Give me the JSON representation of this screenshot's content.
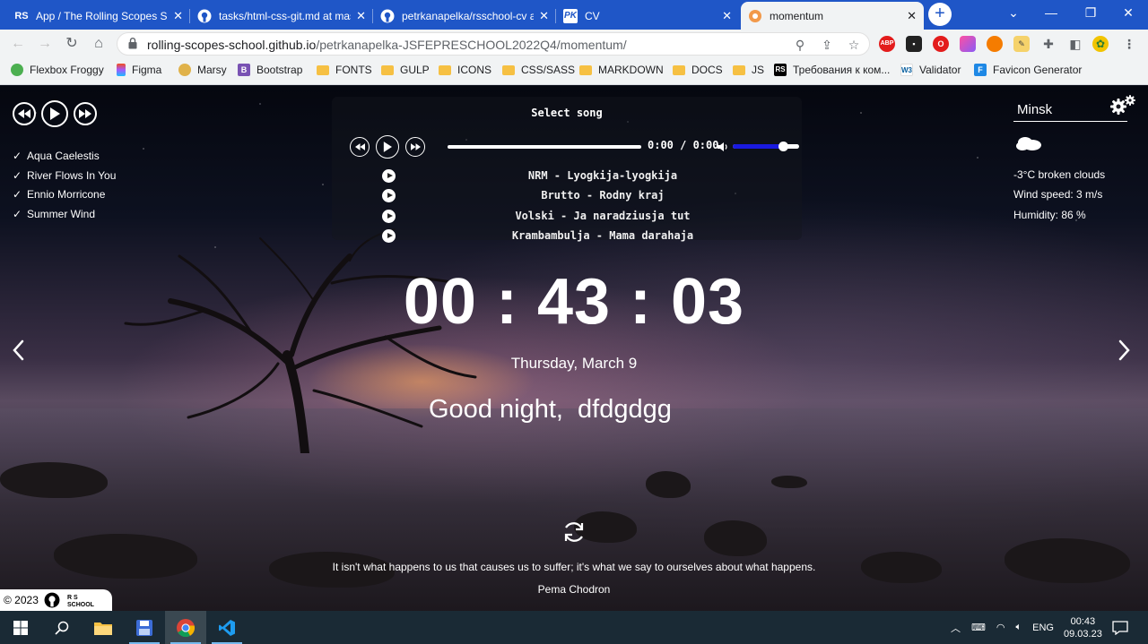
{
  "browser": {
    "tabs": [
      {
        "favicon": "RS",
        "title": "App / The Rolling Scopes Sch",
        "active": false
      },
      {
        "favicon": "github-icon",
        "title": "tasks/html-css-git.md at mas",
        "active": false
      },
      {
        "favicon": "github-icon",
        "title": "petrkanapelka/rsschool-cv at",
        "active": false
      },
      {
        "favicon": "PK",
        "title": "CV",
        "active": false
      },
      {
        "favicon": "momentum-icon",
        "title": "momentum",
        "active": true
      }
    ],
    "url_host": "rolling-scopes-school.github.io",
    "url_path": "/petrkanapelka-JSFEPRESCHOOL2022Q4/momentum/",
    "bookmarks": [
      {
        "icon": "froggy-icon",
        "label": "Flexbox Froggy"
      },
      {
        "icon": "figma-icon",
        "label": "Figma"
      },
      {
        "icon": "marsy-icon",
        "label": "Marsy"
      },
      {
        "icon": "bootstrap-icon",
        "label": "Bootstrap"
      },
      {
        "icon": "folder-icon",
        "label": "FONTS"
      },
      {
        "icon": "folder-icon",
        "label": "GULP"
      },
      {
        "icon": "folder-icon",
        "label": "ICONS"
      },
      {
        "icon": "folder-icon",
        "label": "CSS/SASS"
      },
      {
        "icon": "folder-icon",
        "label": "MARKDOWN"
      },
      {
        "icon": "folder-icon",
        "label": "DOCS"
      },
      {
        "icon": "folder-icon",
        "label": "JS"
      },
      {
        "icon": "rs-icon",
        "label": "Требования к ком..."
      },
      {
        "icon": "w3c-icon",
        "label": "Validator"
      },
      {
        "icon": "favicon-generator-icon",
        "label": "Favicon Generator"
      }
    ]
  },
  "player": {
    "select_song": "Select song",
    "time_display": "0:00 / 0:00",
    "progress": 1.0,
    "volume": 0.75,
    "playlist": [
      "Aqua Caelestis",
      "River Flows In You",
      "Ennio Morricone",
      "Summer Wind"
    ],
    "songs": [
      "NRM - Lyogkija-lyogkija",
      "Brutto - Rodny kraj",
      "Volski - Ja naradziusja tut",
      "Krambambulja - Mama darahaja"
    ]
  },
  "weather": {
    "city": "Minsk",
    "description": "-3°C  broken clouds",
    "wind": "Wind speed: 3 m/s",
    "humidity": "Humidity: 86 %"
  },
  "clock": {
    "time": "00 : 43 : 03",
    "date": "Thursday, March 9",
    "greeting": "Good night,  dfdgdgg"
  },
  "quote": {
    "text": "It isn't what happens to us that causes us to suffer; it's what we say to ourselves about what happens.",
    "author": "Pema Chodron"
  },
  "footer": {
    "copyright": "© 2023"
  },
  "taskbar": {
    "language": "ENG",
    "time": "00:43",
    "date": "09.03.23"
  }
}
